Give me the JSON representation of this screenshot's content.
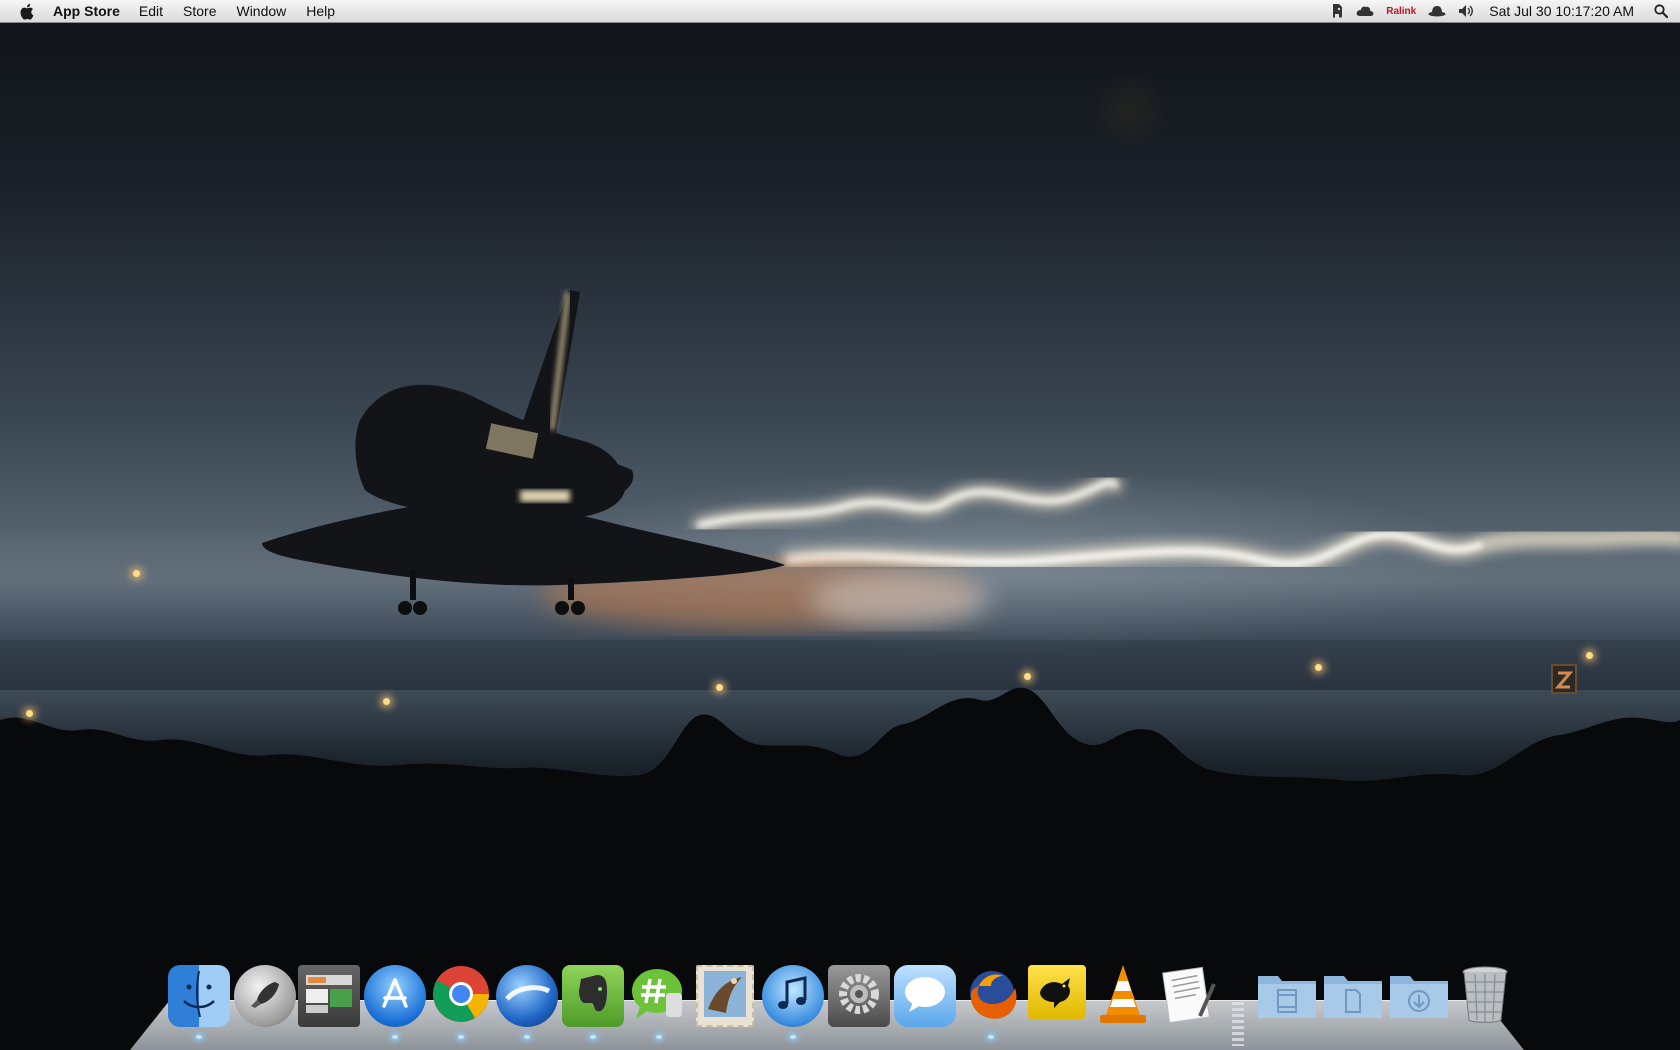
{
  "menubar": {
    "app_name": "App Store",
    "menus": [
      "Edit",
      "Store",
      "Window",
      "Help"
    ],
    "status": {
      "ralink_label": "Ralink",
      "datetime": "Sat Jul 30  10:17:20 AM"
    }
  },
  "dock": {
    "apps": [
      {
        "name": "Finder",
        "icon": "finder-icon",
        "running": true
      },
      {
        "name": "Launchpad",
        "icon": "rocket-icon",
        "running": false
      },
      {
        "name": "Image Capture",
        "icon": "photo-browser-icon",
        "running": false
      },
      {
        "name": "App Store",
        "icon": "app-store-icon",
        "running": true
      },
      {
        "name": "Google Chrome",
        "icon": "chrome-icon",
        "running": true
      },
      {
        "name": "Google Earth",
        "icon": "earth-icon",
        "running": true
      },
      {
        "name": "Evernote",
        "icon": "evernote-elephant-icon",
        "running": true
      },
      {
        "name": "Hash Chat",
        "icon": "chat-hash-icon",
        "running": true
      },
      {
        "name": "Mail",
        "icon": "mail-stamp-icon",
        "running": false
      },
      {
        "name": "iTunes",
        "icon": "itunes-note-icon",
        "running": true
      },
      {
        "name": "System Preferences",
        "icon": "gear-icon",
        "running": false
      },
      {
        "name": "Messages",
        "icon": "speech-bubble-icon",
        "running": false
      },
      {
        "name": "Firefox",
        "icon": "firefox-icon",
        "running": true
      },
      {
        "name": "Tweetie",
        "icon": "bird-icon",
        "running": false
      },
      {
        "name": "VLC",
        "icon": "traffic-cone-icon",
        "running": false
      },
      {
        "name": "TextEdit",
        "icon": "document-pen-icon",
        "running": false
      }
    ],
    "stacks": [
      {
        "name": "Movies",
        "icon": "movies-folder-icon"
      },
      {
        "name": "Documents",
        "icon": "documents-folder-icon"
      },
      {
        "name": "Downloads",
        "icon": "downloads-folder-icon"
      }
    ],
    "trash": {
      "name": "Trash",
      "icon": "trash-icon"
    }
  },
  "colors": {
    "menubar_top": "#f6f6f6",
    "menubar_bottom": "#d9d9d9",
    "sky_dark": "#101318",
    "horizon": "#56636f",
    "plume": "#fff3d6"
  }
}
